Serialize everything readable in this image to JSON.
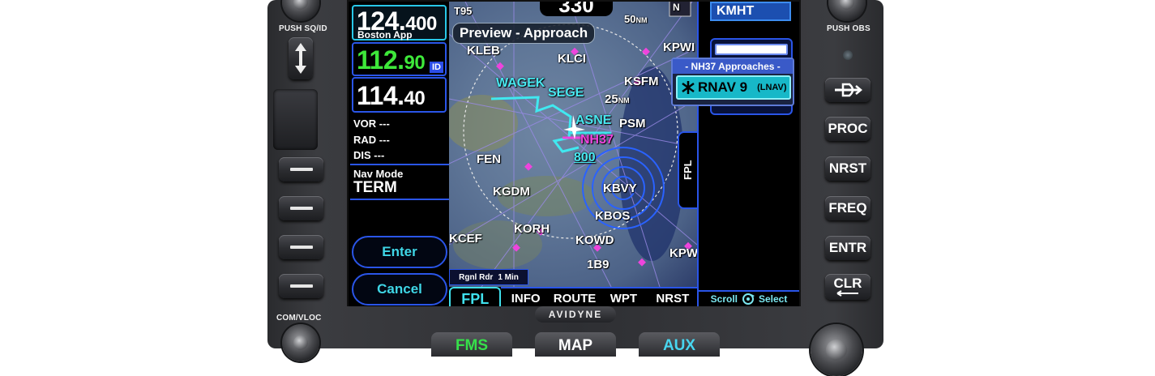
{
  "colors": {
    "accent_cyan": "#3fe0ec",
    "frame_blue": "#2a55e8",
    "active_green": "#3ee83a",
    "magenta": "#ee44dd",
    "fms_green": "#36e04a",
    "aux_cyan": "#48d6f0"
  },
  "panel": {
    "left_knob_label": "PUSH SQ/ID",
    "swap_icon": "up-down-arrow-icon",
    "com_vloc_label": "COM/VLOC",
    "right_knob_label": "PUSH OBS",
    "brand": "AVIDYNE",
    "right_buttons": [
      {
        "label": "",
        "icon": "direct-to-icon"
      },
      {
        "label": "PROC"
      },
      {
        "label": "NRST"
      },
      {
        "label": "FREQ"
      },
      {
        "label": "ENTR"
      },
      {
        "label": "CLR"
      }
    ],
    "bottom_keys": [
      {
        "label": "FMS"
      },
      {
        "label": "MAP"
      },
      {
        "label": "AUX"
      }
    ]
  },
  "com": {
    "active_freq_major": "124.",
    "active_freq_minor": "400",
    "active_name": "Boston App",
    "standby_freq_major": "112.",
    "standby_freq_minor": "90",
    "standby_id_tag": "ID",
    "nav_freq_major": "114.",
    "nav_freq_minor": "40"
  },
  "nav_info": {
    "vor_label": "VOR",
    "vor_value": "---",
    "rad_label": "RAD",
    "rad_value": "---",
    "dis_label": "DIS",
    "dis_value": "---",
    "mode_label": "Nav Mode",
    "mode_value": "TERM"
  },
  "soft_keys": {
    "enter": "Enter",
    "cancel": "Cancel"
  },
  "map": {
    "range_value": "330",
    "title": "Preview - Approach",
    "radar_label": "Rgnl Rdr",
    "radar_time": "1 Min",
    "labels": {
      "t95": "T95",
      "kleb": "KLEB",
      "klci": "KLCI",
      "wagek": "WAGEK",
      "sege": "SEGE",
      "asne": "ASNE",
      "nh37": "NH37",
      "ksfm": "KSFM",
      "psm": "PSM",
      "fen": "FEN",
      "kgdm": "KGDM",
      "kbvy": "KBVY",
      "kbos": "KBOS",
      "kcef": "KCEF",
      "korh": "KORH",
      "kowd": "KOWD",
      "b9": "1B9",
      "kpw": "KPW",
      "kpwm": "KPWI",
      "alt_800": "800",
      "nm25": "25",
      "nm50": "50",
      "nm_unit": "NM",
      "n": "N"
    }
  },
  "tabs": [
    "FPL",
    "INFO",
    "ROUTE",
    "WPT",
    "NRST"
  ],
  "right_pane": {
    "airport": "KMHT",
    "fpl_tab": "FPL",
    "popup_title": "- NH37 Approaches -",
    "approach_icon": "rnav-approach-icon",
    "approach_name": "RNAV 9",
    "approach_type": "(LNAV)",
    "scroll_label": "Scroll",
    "select_label": "Select",
    "scroll_icon": "knob-rotate-icon"
  }
}
